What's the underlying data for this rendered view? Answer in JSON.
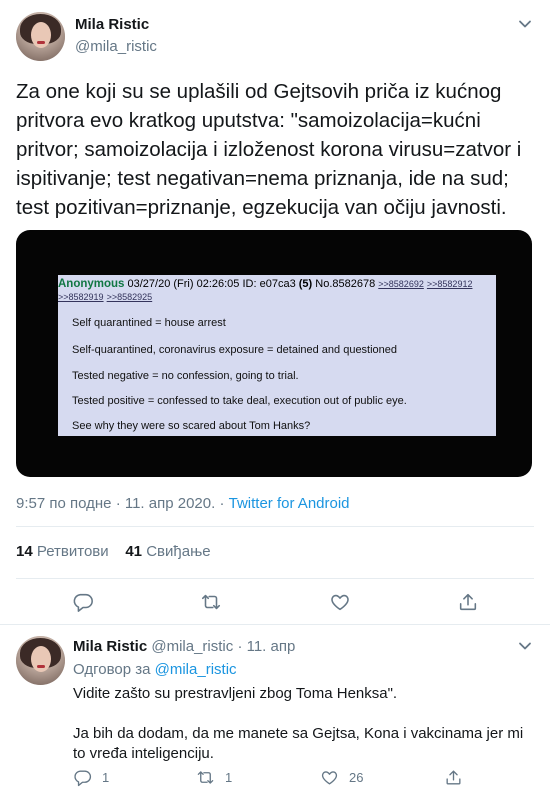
{
  "tweet": {
    "author_name": "Mila Ristic",
    "author_handle": "@mila_ristic",
    "text": "Za one koji su se uplašili od Gejtsovih priča iz kućnog pritvora evo kratkog uputstva: \"samoizolacija=kućni pritvor; samoizolacija i izloženost korona virusu=zatvor i ispitivanje; test negativan=nema priznanja, ide na sud; test pozitivan=priznanje, egzekucija van očiju javnosti.",
    "image": {
      "poster": "Anonymous",
      "date": "03/27/20 (Fri) 02:26:05",
      "id": "ID: e07ca3",
      "id_count": "(5)",
      "post_no": "No.8582678",
      "links_line1": [
        ">>8582692",
        ">>8582912"
      ],
      "links_line2": [
        ">>8582919",
        ">>8582925"
      ],
      "lines": [
        "Self quarantined = house arrest",
        "Self-quarantined, coronavirus exposure = detained and questioned",
        "Tested negative = no confession, going to trial.",
        "Tested positive = confessed to take deal, execution out of public eye.",
        "See why they were so scared about Tom Hanks?"
      ]
    },
    "time": "9:57 по подне",
    "dot": "·",
    "date": "11. апр 2020.",
    "source": "Twitter for Android",
    "retweets_count": "14",
    "retweets_label": "Ретвитови",
    "likes_count": "41",
    "likes_label": "Свиђање"
  },
  "reply": {
    "author_name": "Mila Ristic",
    "author_handle": "@mila_ristic",
    "dot": "·",
    "date": "11. апр",
    "reply_prefix": "Одговор за",
    "reply_to": "@mila_ristic",
    "text_line1": "Vidite zašto su prestravljeni zbog Toma Henksa\".",
    "text_line2": "Ja bih da dodam, da me manete sa Gejtsa, Kona i vakcinama jer mi to vređa inteligenciju.",
    "reply_count": "1",
    "retweet_count": "1",
    "like_count": "26"
  },
  "colors": {
    "text": "#14171a",
    "secondary": "#657786",
    "link": "#1b95e0",
    "divider": "#e6ecf0"
  }
}
